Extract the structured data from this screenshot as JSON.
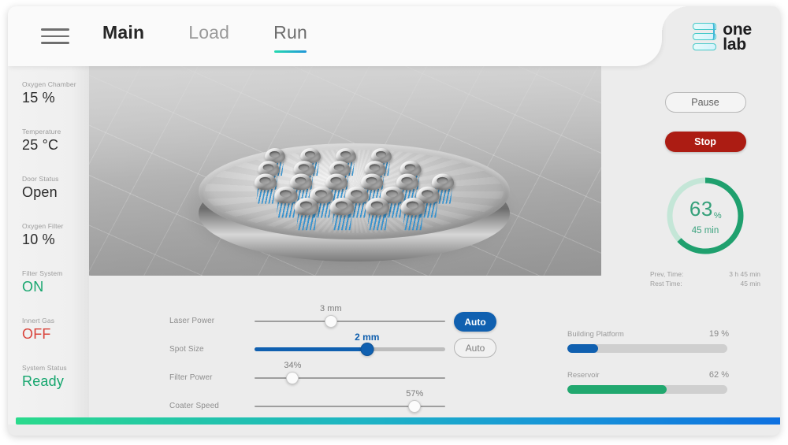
{
  "header": {
    "menu_icon": "hamburger-icon",
    "tabs": [
      {
        "label": "Main",
        "state": "active"
      },
      {
        "label": "Load",
        "state": "inactive"
      },
      {
        "label": "Run",
        "state": "selected"
      }
    ],
    "logo": {
      "line1": "one",
      "line2": "lab",
      "mark": "stacked-bars-logo-icon"
    }
  },
  "sidebar": {
    "stats": [
      {
        "label": "Oxygen Chamber",
        "value": "15 %",
        "tone": "default"
      },
      {
        "label": "Temperature",
        "value": "25 °C",
        "tone": "default"
      },
      {
        "label": "Door Status",
        "value": "Open",
        "tone": "default"
      },
      {
        "label": "Oxygen Filter",
        "value": "10 %",
        "tone": "default"
      },
      {
        "label": "Filter System",
        "value": "ON",
        "tone": "green"
      },
      {
        "label": "Innert Gas",
        "value": "OFF",
        "tone": "red"
      },
      {
        "label": "System Status",
        "value": "Ready",
        "tone": "green"
      }
    ]
  },
  "viewport": {
    "scene": "3d-build-plate-with-dental-parts",
    "part_count": 24
  },
  "controls": {
    "pause_label": "Pause",
    "stop_label": "Stop",
    "progress": {
      "percent": 63,
      "percent_text": "63",
      "percent_symbol": "%",
      "remaining": "45 min",
      "ring_color": "#1fa06e",
      "ring_track_color": "#c4e6d7"
    },
    "times": [
      {
        "key": "Prev, Time:",
        "value": "3 h 45 min"
      },
      {
        "key": "Rest Time:",
        "value": "45 min"
      }
    ]
  },
  "sliders": [
    {
      "label": "Laser Power",
      "value_text": "3 mm",
      "position": 40,
      "active": false
    },
    {
      "label": "Spot Size",
      "value_text": "2 mm",
      "position": 59,
      "active": true
    },
    {
      "label": "Filter Power",
      "value_text": "34%",
      "position": 20,
      "active": false
    },
    {
      "label": "Coater Speed",
      "value_text": "57%",
      "position": 84,
      "active": false
    }
  ],
  "auto_buttons": [
    {
      "label": "Auto",
      "state": "on"
    },
    {
      "label": "Auto",
      "state": "off"
    }
  ],
  "meters": [
    {
      "label": "Building Platform",
      "value_text": "19 %",
      "percent": 19,
      "color": "#1060b0"
    },
    {
      "label": "Reservoir",
      "value_text": "62 %",
      "percent": 62,
      "color": "#21a86f"
    }
  ],
  "accent": {
    "gradient_start": "#2ada8c",
    "gradient_end": "#0e6fe0",
    "blue": "#1060b0",
    "green": "#21a86f",
    "red": "#ac1c13"
  }
}
